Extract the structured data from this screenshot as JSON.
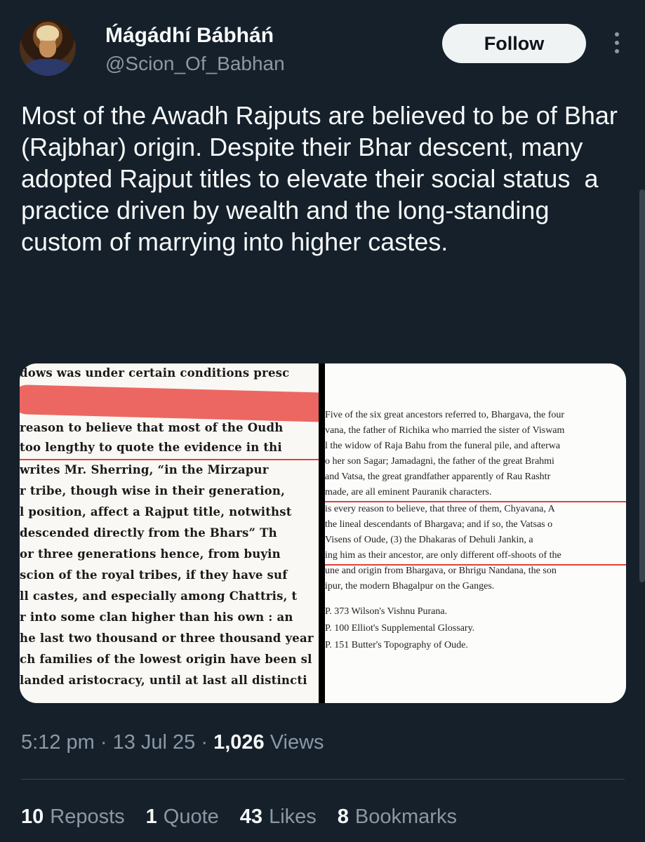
{
  "author": {
    "display_name": "Ḿágádhí Bábháń",
    "handle": "@Scion_Of_Babhan"
  },
  "follow_label": "Follow",
  "tweet_text": "Most of the Awadh Rajputs are believed to be of Bhar (Rajbhar) origin. Despite their Bhar descent, many adopted Rajput titles to elevate their social status  a practice driven by wealth and the long-standing custom of marrying into higher castes.",
  "images": {
    "left_lines": [
      "dows was under certain conditions presc",
      "reason to believe that most of the Oudh",
      "too lengthy to quote the evidence in thi",
      "writes Mr. Sherring, “in the Mirzapur",
      "r tribe, though wise in their generation,",
      "l position, affect a Rajput title, notwithst",
      "descended directly from the Bhars”  Th",
      "or three generations hence, from buyin",
      "scion of the royal tribes, if they have suf",
      "ll castes, and especially among Chattris, t",
      "r into some clan higher than his own : an",
      "he last two thousand or three thousand year",
      "ch families of the lowest origin have been sl",
      "landed aristocracy, until at last all distincti"
    ],
    "right_lines": [
      "Five of the six great ancestors referred to, Bhargava, the four",
      "vana, the father of Richika who married the sister of Viswam",
      "l the widow of Raja Bahu from the funeral pile, and afterwa",
      "o her son Sagar; Jamadagni, the father of the great Brahmi",
      "and Vatsa, the great grandfather apparently of Rau Rashtr",
      "made, are all eminent Pauranik characters.",
      "is every reason to believe, that three of them, Chyavana, A",
      "the lineal descendants of Bhargava; and if so, the Vatsas o",
      "Visens of Oude, (3) the Dhakaras of Dehuli Jankin, a",
      "ing him as their ancestor, are only different off-shoots of the",
      "une and origin from Bhargava, or Bhrigu Nandana, the son",
      "ipur, the modern Bhagalpur on the Ganges.",
      "P. 373 Wilson's Vishnu Purana.",
      "P. 100 Elliot's Supplemental Glossary.",
      "P. 151 Butter's Topography of Oude."
    ]
  },
  "meta": {
    "time": "5:12 pm",
    "date": "13 Jul 25",
    "views_count": "1,026",
    "views_label": "Views"
  },
  "stats": [
    {
      "count": "10",
      "label": "Reposts"
    },
    {
      "count": "1",
      "label": "Quote"
    },
    {
      "count": "43",
      "label": "Likes"
    },
    {
      "count": "8",
      "label": "Bookmarks"
    }
  ],
  "colors": {
    "background": "#15202b",
    "text": "#f7f9f9",
    "muted": "#8b98a5",
    "highlight_red": "#ec5a55"
  }
}
